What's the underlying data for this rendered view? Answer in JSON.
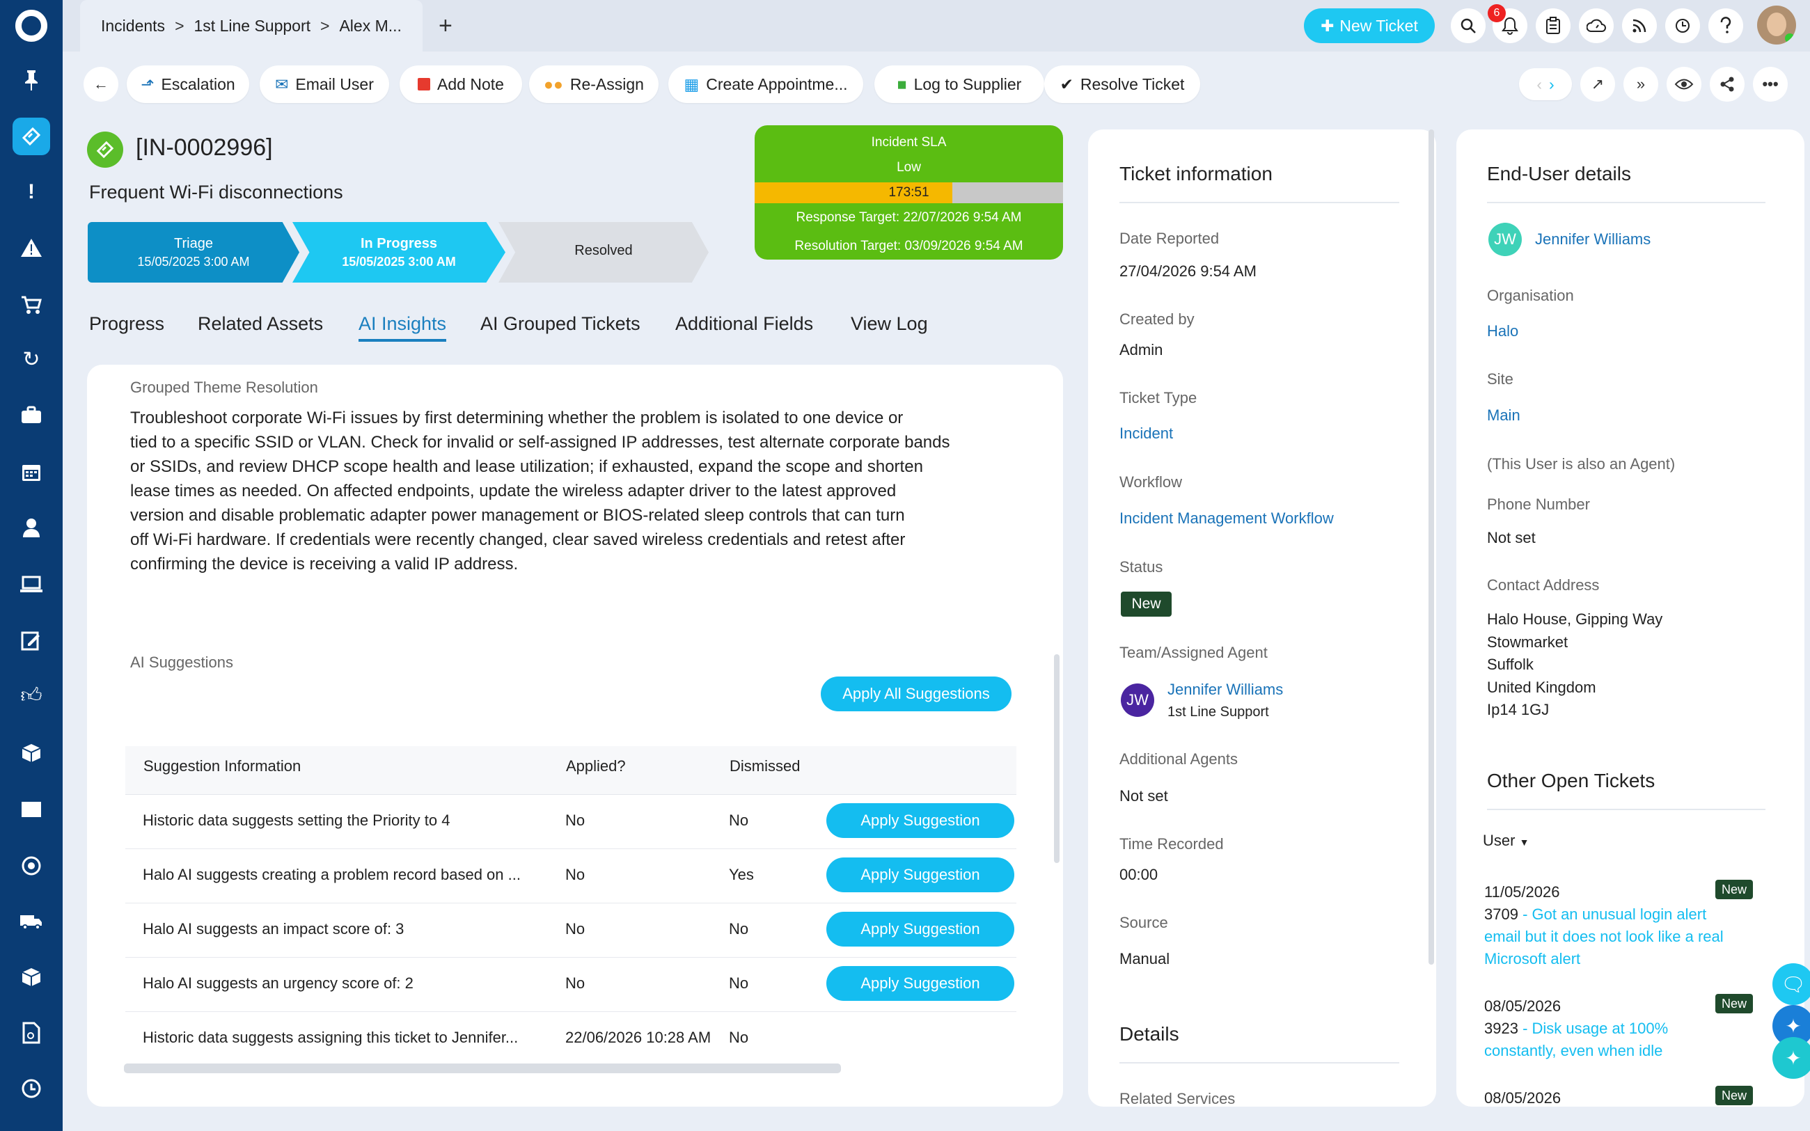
{
  "nav": {
    "items": [
      "pin-icon",
      "ticket-icon",
      "exclamation-icon",
      "warning-icon",
      "cart-icon",
      "sync-icon",
      "briefcase-icon",
      "calendar-icon",
      "user-icon",
      "laptop-icon",
      "edit-icon",
      "thumbs-up-icon",
      "box-icon",
      "book-icon",
      "gauge-icon",
      "truck-icon",
      "package-icon",
      "document-icon",
      "clock-icon"
    ],
    "active": "ticket-icon"
  },
  "breadcrumb": {
    "b1": "Incidents",
    "b2": "1st Line Support",
    "b3": "Alex M...",
    "sep": ">",
    "add": "+"
  },
  "topbar": {
    "new_ticket": "New Ticket",
    "notifications": "6"
  },
  "actions": {
    "escalation": "Escalation",
    "email_user": "Email User",
    "add_note": "Add Note",
    "reassign": "Re-Assign",
    "appointment": "Create Appointme...",
    "supplier": "Log to Supplier",
    "resolve": "Resolve Ticket"
  },
  "ticket": {
    "id": "[IN-0002996]",
    "summary": "Frequent Wi-Fi disconnections"
  },
  "stages": [
    {
      "name": "Triage",
      "date": "15/05/2025 3:00 AM"
    },
    {
      "name": "In Progress",
      "date": "15/05/2025 3:00 AM"
    },
    {
      "name": "Resolved",
      "date": ""
    }
  ],
  "sla": {
    "title": "Incident SLA",
    "priority": "Low",
    "timer": "173:51",
    "progress": 0.64,
    "response": "Response Target: 22/07/2026 9:54 AM",
    "resolution": "Resolution Target: 03/09/2026 9:54 AM"
  },
  "tabs": [
    "Progress",
    "Related Assets",
    "AI Insights",
    "AI Grouped Tickets",
    "Additional Fields",
    "View Log"
  ],
  "insights": {
    "grouped_label": "Grouped Theme Resolution",
    "lines": [
      "Troubleshoot corporate Wi-Fi issues by first determining whether the problem is isolated to one device or",
      "tied to a specific SSID or VLAN. Check for invalid or self-assigned IP addresses, test alternate corporate bands",
      "or SSIDs, and review DHCP scope health and lease utilization; if exhausted, expand the scope and shorten",
      "lease times as needed. On affected endpoints, update the wireless adapter driver to the latest approved",
      "version and disable problematic adapter power management or BIOS-related sleep controls that can turn",
      "off Wi-Fi hardware. If credentials were recently changed, clear saved wireless credentials and retest after",
      "confirming the device is receiving a valid IP address."
    ],
    "suggestions_label": "AI Suggestions",
    "apply_all": "Apply All Suggestions"
  },
  "suggestions_table": {
    "headers": [
      "Suggestion Information",
      "Applied?",
      "Dismissed"
    ],
    "rows": [
      {
        "info": "Historic data suggests setting the Priority to 4",
        "applied": "No",
        "dismissed": "No",
        "button": "Apply Suggestion"
      },
      {
        "info": "Halo AI suggests creating a problem record based on ...",
        "applied": "No",
        "dismissed": "Yes",
        "button": "Apply Suggestion"
      },
      {
        "info": "Halo AI suggests an impact score of: 3",
        "applied": "No",
        "dismissed": "No",
        "button": "Apply Suggestion"
      },
      {
        "info": "Halo AI suggests an urgency score of: 2",
        "applied": "No",
        "dismissed": "No",
        "button": "Apply Suggestion"
      },
      {
        "info": "Historic data suggests assigning this ticket to Jennifer...",
        "applied": "22/06/2026 10:28 AM",
        "dismissed": "No",
        "button": ""
      }
    ]
  },
  "ticket_info": {
    "title": "Ticket information",
    "date_reported_label": "Date Reported",
    "date_reported": "27/04/2026 9:54 AM",
    "created_by_label": "Created by",
    "created_by": "Admin",
    "type_label": "Ticket Type",
    "type": "Incident",
    "workflow_label": "Workflow",
    "workflow": "Incident Management Workflow",
    "status_label": "Status",
    "status": "New",
    "team_label": "Team/Assigned Agent",
    "agent_initials": "JW",
    "agent_name": "Jennifer Williams",
    "agent_team": "1st Line Support",
    "additional_label": "Additional Agents",
    "additional": "Not set",
    "time_label": "Time Recorded",
    "time": "00:00",
    "source_label": "Source",
    "source": "Manual",
    "details_title": "Details",
    "related_label": "Related Services"
  },
  "enduser": {
    "title": "End-User details",
    "initials": "JW",
    "name": "Jennifer Williams",
    "org_label": "Organisation",
    "org": "Halo",
    "site_label": "Site",
    "site": "Main",
    "agent_note": "(This User is also an Agent)",
    "phone_label": "Phone Number",
    "phone": "Not set",
    "address_label": "Contact Address",
    "address": [
      "Halo House, Gipping Way",
      "Stowmarket",
      "Suffolk",
      "United Kingdom",
      "Ip14 1GJ"
    ],
    "other_title": "Other Open Tickets",
    "filter": "User",
    "tickets": [
      {
        "date": "11/05/2026",
        "num": "3709",
        "text1": " - Got an unusual login alert",
        "text2": "email but it does not look like a real",
        "text3": "Microsoft alert",
        "tag": "New"
      },
      {
        "date": "08/05/2026",
        "num": "3923",
        "text1": " - Disk usage at 100%",
        "text2": "constantly, even when idle",
        "text3": "",
        "tag": "New"
      },
      {
        "date": "08/05/2026",
        "num": "",
        "text1": "",
        "text2": "",
        "text3": "",
        "tag": "New"
      }
    ]
  },
  "colors": {
    "nav": "#0a3c74",
    "accent": "#14bdf0",
    "sla_green": "#5bbd12",
    "link": "#1a73b8"
  }
}
